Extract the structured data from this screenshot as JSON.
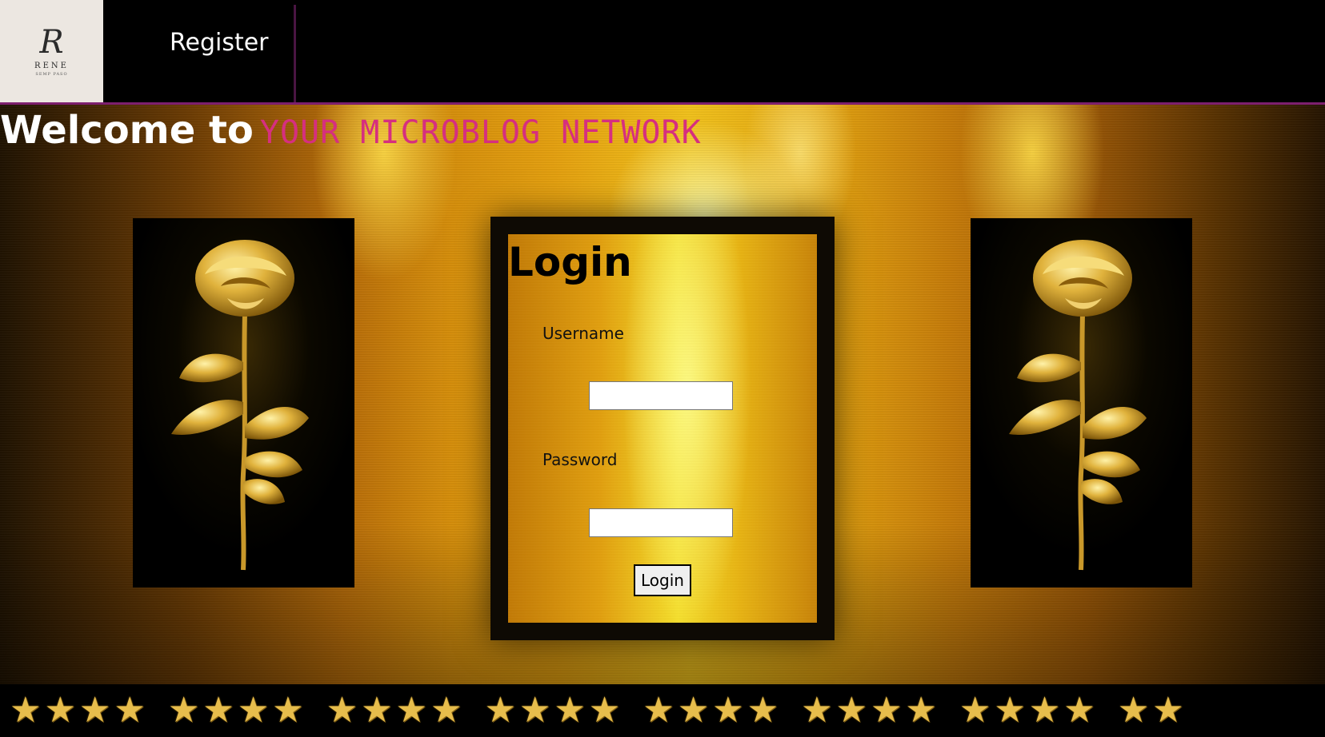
{
  "logo": {
    "letter": "R",
    "name": "RENE",
    "tagline": "SEMP PASO"
  },
  "nav": {
    "register_label": "Register"
  },
  "welcome": {
    "prefix": "Welcome to",
    "brand": "YOUR MICROBLOG NETWORK"
  },
  "login": {
    "title": "Login",
    "username_label": "Username",
    "username_value": "",
    "password_label": "Password",
    "password_value": "",
    "button_label": "Login"
  },
  "decor": {
    "left_image": "golden-rose-icon",
    "right_image": "golden-rose-icon",
    "footer_icon": "star-icon",
    "colors": {
      "brand_text": "#d62f7f",
      "nav_accent": "#7d1f6e",
      "gold": "#e7bd4c"
    }
  }
}
